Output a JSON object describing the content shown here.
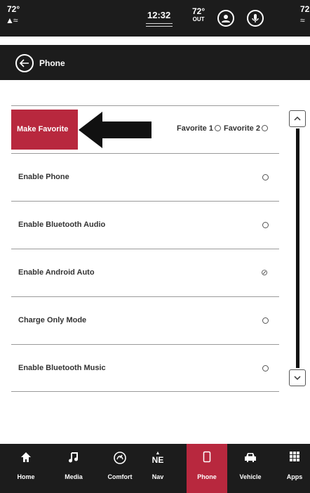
{
  "status_bar": {
    "left_temp": "72°",
    "clock": "12:32",
    "outside_temp": "72°",
    "outside_label": "OUT",
    "right_temp": "72"
  },
  "header": {
    "title": "Phone"
  },
  "favorite": {
    "button_label": "Make Favorite",
    "option_1": "Favorite 1",
    "option_2": "Favorite 2"
  },
  "settings": [
    {
      "label": "Enable Phone",
      "state": "radio"
    },
    {
      "label": "Enable Bluetooth Audio",
      "state": "radio"
    },
    {
      "label": "Enable Android Auto",
      "state": "checked"
    },
    {
      "label": "Charge Only Mode",
      "state": "radio"
    },
    {
      "label": "Enable Bluetooth Music",
      "state": "radio"
    }
  ],
  "bottom_nav": [
    {
      "label": "Home",
      "icon": "home-icon"
    },
    {
      "label": "Media",
      "icon": "music-note-icon"
    },
    {
      "label": "Comfort",
      "icon": "comfort-icon"
    },
    {
      "label": "Nav",
      "icon": "compass-icon",
      "heading": "NE"
    },
    {
      "label": "Phone",
      "icon": "phone-icon",
      "active": true
    },
    {
      "label": "Vehicle",
      "icon": "car-icon"
    },
    {
      "label": "Apps",
      "icon": "apps-grid-icon"
    }
  ],
  "colors": {
    "accent": "#b8283e",
    "bar_background": "#1c1c1c"
  }
}
